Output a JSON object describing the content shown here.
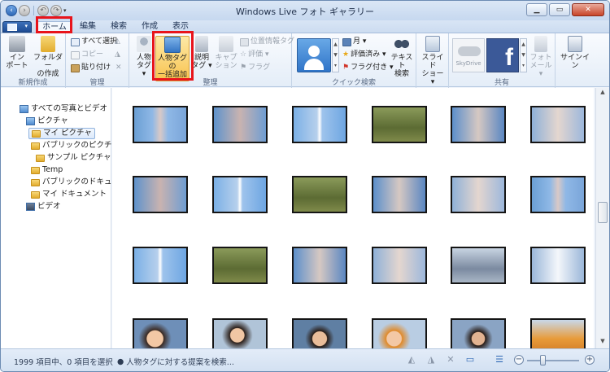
{
  "window": {
    "title": "Windows Live フォト ギャラリー",
    "qat_more": "▾"
  },
  "tabs": [
    "ホーム",
    "編集",
    "検索",
    "作成",
    "表示"
  ],
  "ribbon": {
    "new": {
      "import": "イン\nポート",
      "folder": "フォルダー\nの作成",
      "label": "新規作成"
    },
    "manage": {
      "select_all": "すべて選択",
      "copy": "コピー",
      "paste": "貼り付け",
      "label": "管理"
    },
    "organize": {
      "person": "人物\nタグ ▾",
      "bulk_person": "人物タグの\n一括追加",
      "desc": "説明\nタグ ▾",
      "caption": "キャプ\nション",
      "geotag": "位置情報タグ",
      "rating": "評価 ▾",
      "flag": "フラグ",
      "label": "整理"
    },
    "quick": {
      "month": "月 ▾",
      "rated": "評価済み ▾",
      "flagged": "フラグ付き ▾",
      "text_search": "テキスト\n検索",
      "label": "クイック検索"
    },
    "share": {
      "slideshow": "スライド\nショー ▾",
      "skydrive": "SkyDrive",
      "photo_mail": "フォト\nメール ▾",
      "label": "共有"
    },
    "signin": "サインイン"
  },
  "nav": {
    "items": [
      {
        "label": "すべての写真とビデオ",
        "kind": "pics",
        "level": 0
      },
      {
        "label": "ピクチャ",
        "kind": "pics",
        "level": 1
      },
      {
        "label": "マイ ピクチャ",
        "kind": "fold",
        "level": 2,
        "selected": true
      },
      {
        "label": "パブリックのピクチャ",
        "kind": "fold",
        "level": 2
      },
      {
        "label": "サンプル ピクチャ",
        "kind": "fold",
        "level": 3
      },
      {
        "label": "Temp",
        "kind": "fold",
        "level": 2
      },
      {
        "label": "パブリックのドキュメ",
        "kind": "fold",
        "level": 2
      },
      {
        "label": "マイ ドキュメント",
        "kind": "fold",
        "level": 2
      },
      {
        "label": "ビデオ",
        "kind": "vid",
        "level": 1
      }
    ]
  },
  "status": {
    "count": "1999 項目中、0 項目を選択",
    "hint": "人物タグに対する提案を検索..."
  },
  "colors": {
    "accent": "#e8141b",
    "ribbon": "#e4edf8",
    "title": "#c6d8ef"
  }
}
